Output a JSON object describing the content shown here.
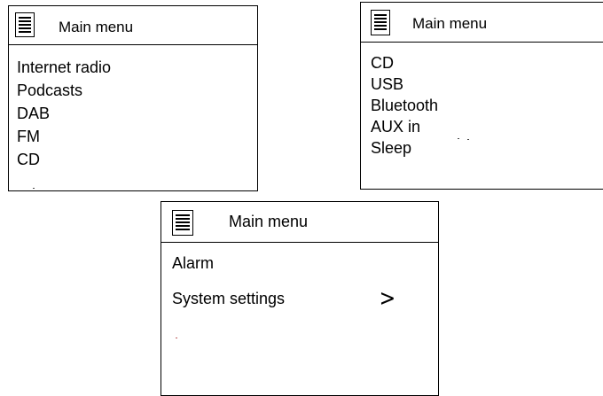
{
  "panels": [
    {
      "title": "Main menu",
      "icon": "menu-list-icon",
      "items": [
        "Internet radio",
        "Podcasts",
        "DAB",
        "FM",
        "CD"
      ]
    },
    {
      "title": "Main menu",
      "icon": "menu-list-icon",
      "items": [
        "CD",
        "USB",
        "Bluetooth",
        "AUX in",
        "Sleep"
      ]
    },
    {
      "title": "Main menu",
      "icon": "menu-list-icon",
      "items": [
        "Alarm",
        "System settings"
      ],
      "submenu_indicator": ">"
    }
  ]
}
